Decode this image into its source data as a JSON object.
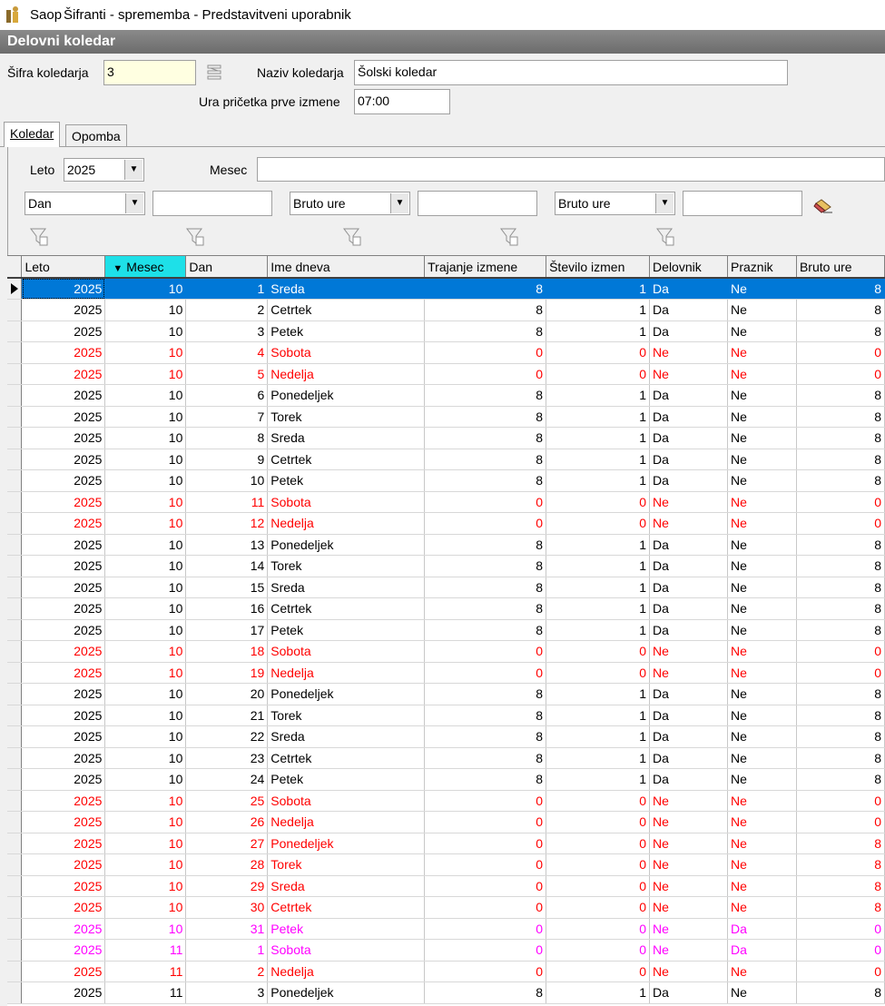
{
  "window": {
    "app_name": "Saop",
    "title": "Šifranti - sprememba - Predstavitveni uporabnik"
  },
  "header": {
    "title": "Delovni koledar"
  },
  "form": {
    "sifra_label": "Šifra koledarja",
    "sifra_value": "3",
    "naziv_label": "Naziv koledarja",
    "naziv_value": "Šolski koledar",
    "ura_label": "Ura pričetka prve izmene",
    "ura_value": "07:00"
  },
  "tabs": [
    {
      "label": "Koledar",
      "active": true
    },
    {
      "label": "Opomba",
      "active": false
    }
  ],
  "filters": {
    "leto_label": "Leto",
    "leto_value": "2025",
    "mesec_label": "Mesec",
    "mesec_value": "",
    "combo1_value": "Dan",
    "text1_value": "",
    "combo2_value": "Bruto ure",
    "text2_value": "",
    "combo3_value": "Bruto ure",
    "text3_value": ""
  },
  "colors": {
    "selection": "#0078d7",
    "weekend": "#ff0000",
    "holiday": "#ff00ff",
    "sorted_header": "#1ee0e8"
  },
  "grid": {
    "columns": [
      "Leto",
      "Mesec",
      "Dan",
      "Ime dneva",
      "Trajanje izmene",
      "Število izmen",
      "Delovnik",
      "Praznik",
      "Bruto ure"
    ],
    "sorted_column_index": 1,
    "rows": [
      {
        "c": [
          "2025",
          "10",
          "1",
          "Sreda",
          "8",
          "1",
          "Da",
          "Ne",
          "8"
        ],
        "style": "sel"
      },
      {
        "c": [
          "2025",
          "10",
          "2",
          "Cetrtek",
          "8",
          "1",
          "Da",
          "Ne",
          "8"
        ],
        "style": ""
      },
      {
        "c": [
          "2025",
          "10",
          "3",
          "Petek",
          "8",
          "1",
          "Da",
          "Ne",
          "8"
        ],
        "style": ""
      },
      {
        "c": [
          "2025",
          "10",
          "4",
          "Sobota",
          "0",
          "0",
          "Ne",
          "Ne",
          "0"
        ],
        "style": "red"
      },
      {
        "c": [
          "2025",
          "10",
          "5",
          "Nedelja",
          "0",
          "0",
          "Ne",
          "Ne",
          "0"
        ],
        "style": "red"
      },
      {
        "c": [
          "2025",
          "10",
          "6",
          "Ponedeljek",
          "8",
          "1",
          "Da",
          "Ne",
          "8"
        ],
        "style": ""
      },
      {
        "c": [
          "2025",
          "10",
          "7",
          "Torek",
          "8",
          "1",
          "Da",
          "Ne",
          "8"
        ],
        "style": ""
      },
      {
        "c": [
          "2025",
          "10",
          "8",
          "Sreda",
          "8",
          "1",
          "Da",
          "Ne",
          "8"
        ],
        "style": ""
      },
      {
        "c": [
          "2025",
          "10",
          "9",
          "Cetrtek",
          "8",
          "1",
          "Da",
          "Ne",
          "8"
        ],
        "style": ""
      },
      {
        "c": [
          "2025",
          "10",
          "10",
          "Petek",
          "8",
          "1",
          "Da",
          "Ne",
          "8"
        ],
        "style": ""
      },
      {
        "c": [
          "2025",
          "10",
          "11",
          "Sobota",
          "0",
          "0",
          "Ne",
          "Ne",
          "0"
        ],
        "style": "red"
      },
      {
        "c": [
          "2025",
          "10",
          "12",
          "Nedelja",
          "0",
          "0",
          "Ne",
          "Ne",
          "0"
        ],
        "style": "red"
      },
      {
        "c": [
          "2025",
          "10",
          "13",
          "Ponedeljek",
          "8",
          "1",
          "Da",
          "Ne",
          "8"
        ],
        "style": ""
      },
      {
        "c": [
          "2025",
          "10",
          "14",
          "Torek",
          "8",
          "1",
          "Da",
          "Ne",
          "8"
        ],
        "style": ""
      },
      {
        "c": [
          "2025",
          "10",
          "15",
          "Sreda",
          "8",
          "1",
          "Da",
          "Ne",
          "8"
        ],
        "style": ""
      },
      {
        "c": [
          "2025",
          "10",
          "16",
          "Cetrtek",
          "8",
          "1",
          "Da",
          "Ne",
          "8"
        ],
        "style": ""
      },
      {
        "c": [
          "2025",
          "10",
          "17",
          "Petek",
          "8",
          "1",
          "Da",
          "Ne",
          "8"
        ],
        "style": ""
      },
      {
        "c": [
          "2025",
          "10",
          "18",
          "Sobota",
          "0",
          "0",
          "Ne",
          "Ne",
          "0"
        ],
        "style": "red"
      },
      {
        "c": [
          "2025",
          "10",
          "19",
          "Nedelja",
          "0",
          "0",
          "Ne",
          "Ne",
          "0"
        ],
        "style": "red"
      },
      {
        "c": [
          "2025",
          "10",
          "20",
          "Ponedeljek",
          "8",
          "1",
          "Da",
          "Ne",
          "8"
        ],
        "style": ""
      },
      {
        "c": [
          "2025",
          "10",
          "21",
          "Torek",
          "8",
          "1",
          "Da",
          "Ne",
          "8"
        ],
        "style": ""
      },
      {
        "c": [
          "2025",
          "10",
          "22",
          "Sreda",
          "8",
          "1",
          "Da",
          "Ne",
          "8"
        ],
        "style": ""
      },
      {
        "c": [
          "2025",
          "10",
          "23",
          "Cetrtek",
          "8",
          "1",
          "Da",
          "Ne",
          "8"
        ],
        "style": ""
      },
      {
        "c": [
          "2025",
          "10",
          "24",
          "Petek",
          "8",
          "1",
          "Da",
          "Ne",
          "8"
        ],
        "style": ""
      },
      {
        "c": [
          "2025",
          "10",
          "25",
          "Sobota",
          "0",
          "0",
          "Ne",
          "Ne",
          "0"
        ],
        "style": "red"
      },
      {
        "c": [
          "2025",
          "10",
          "26",
          "Nedelja",
          "0",
          "0",
          "Ne",
          "Ne",
          "0"
        ],
        "style": "red"
      },
      {
        "c": [
          "2025",
          "10",
          "27",
          "Ponedeljek",
          "0",
          "0",
          "Ne",
          "Ne",
          "8"
        ],
        "style": "red"
      },
      {
        "c": [
          "2025",
          "10",
          "28",
          "Torek",
          "0",
          "0",
          "Ne",
          "Ne",
          "8"
        ],
        "style": "red"
      },
      {
        "c": [
          "2025",
          "10",
          "29",
          "Sreda",
          "0",
          "0",
          "Ne",
          "Ne",
          "8"
        ],
        "style": "red"
      },
      {
        "c": [
          "2025",
          "10",
          "30",
          "Cetrtek",
          "0",
          "0",
          "Ne",
          "Ne",
          "8"
        ],
        "style": "red"
      },
      {
        "c": [
          "2025",
          "10",
          "31",
          "Petek",
          "0",
          "0",
          "Ne",
          "Da",
          "0"
        ],
        "style": "magenta"
      },
      {
        "c": [
          "2025",
          "11",
          "1",
          "Sobota",
          "0",
          "0",
          "Ne",
          "Da",
          "0"
        ],
        "style": "magenta"
      },
      {
        "c": [
          "2025",
          "11",
          "2",
          "Nedelja",
          "0",
          "0",
          "Ne",
          "Ne",
          "0"
        ],
        "style": "red"
      },
      {
        "c": [
          "2025",
          "11",
          "3",
          "Ponedeljek",
          "8",
          "1",
          "Da",
          "Ne",
          "8"
        ],
        "style": ""
      }
    ]
  }
}
